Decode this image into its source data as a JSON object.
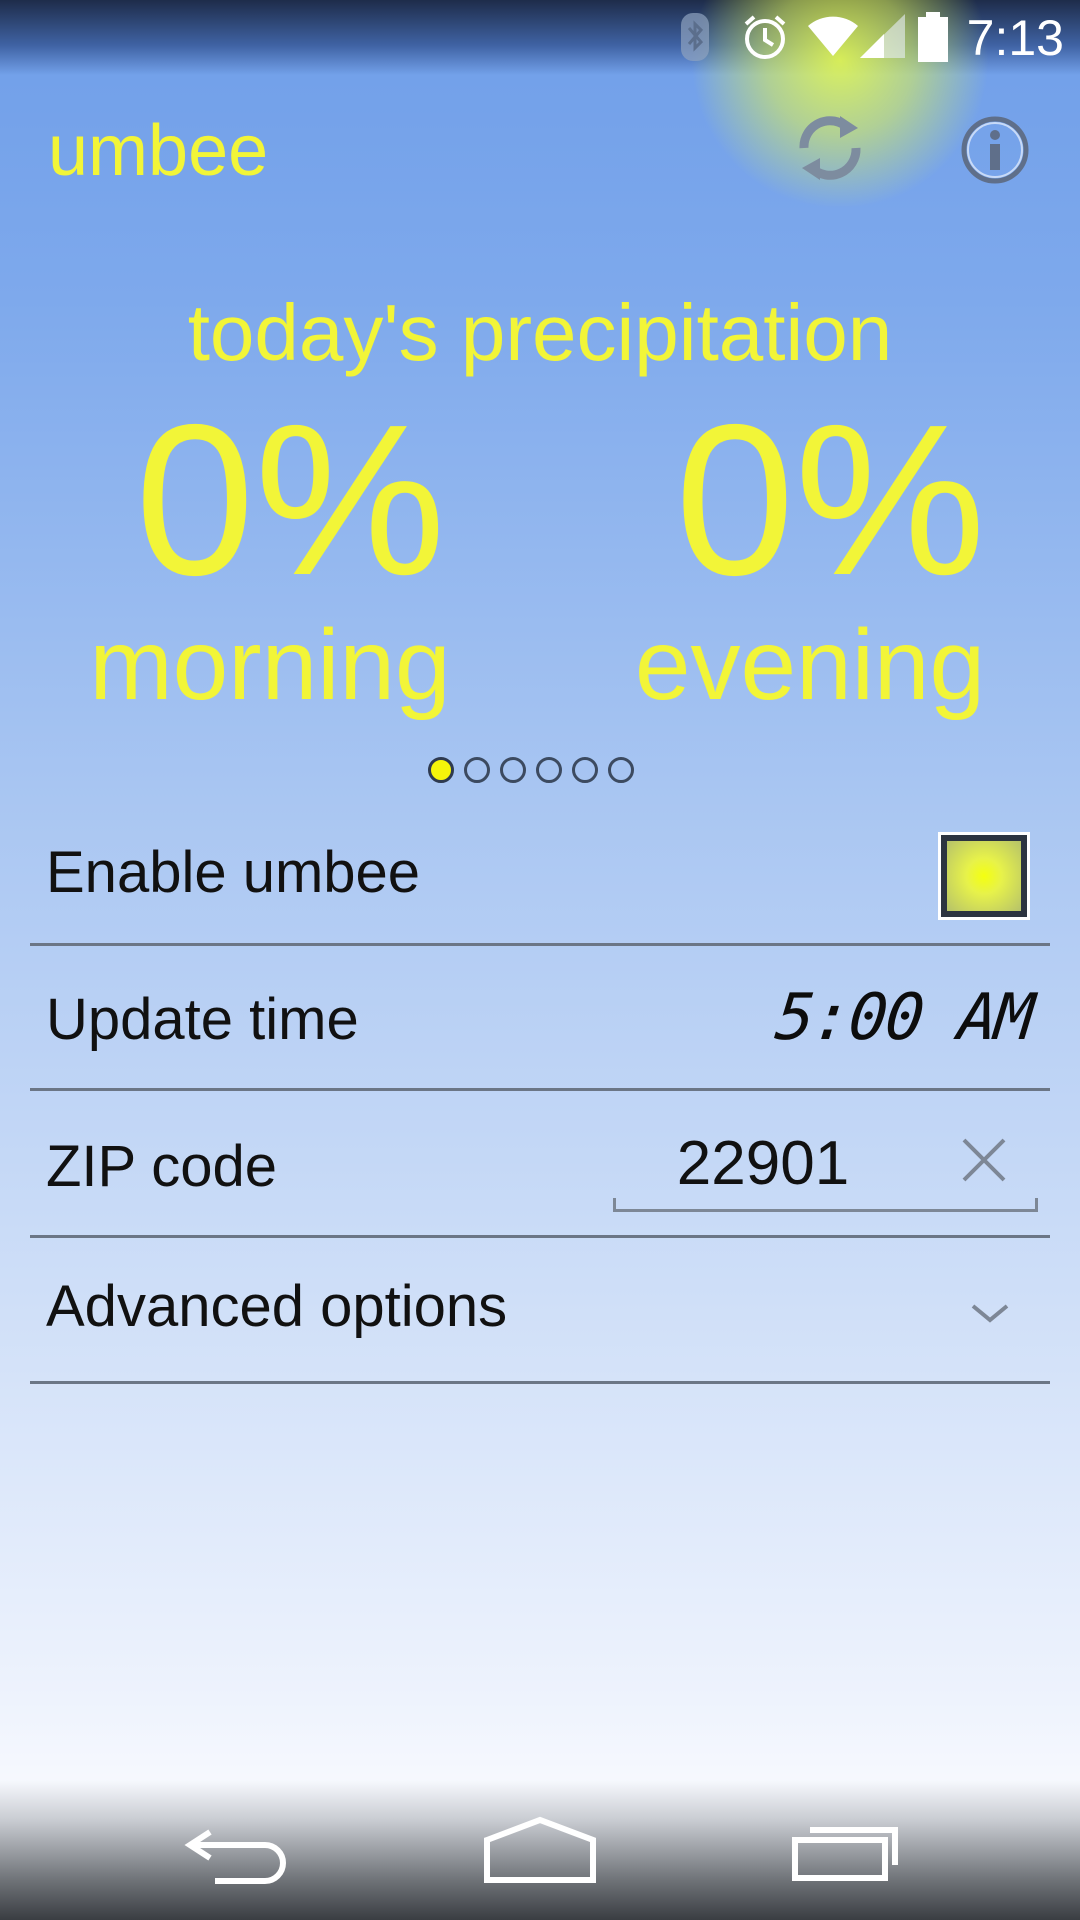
{
  "status_bar": {
    "time": "7:13",
    "icons": [
      "bluetooth-icon",
      "alarm-icon",
      "wifi-icon",
      "signal-icon",
      "battery-icon"
    ]
  },
  "app_bar": {
    "title": "umbee",
    "actions": [
      "refresh-icon",
      "info-icon"
    ]
  },
  "precipitation": {
    "title": "today's precipitation",
    "morning": {
      "value": "0%",
      "label": "morning"
    },
    "evening": {
      "value": "0%",
      "label": "evening"
    }
  },
  "pager": {
    "total": 6,
    "active_index": 0
  },
  "settings": {
    "enable": {
      "label": "Enable umbee",
      "checked": true
    },
    "update_time": {
      "label": "Update time",
      "value": "5:00 AM"
    },
    "zip": {
      "label": "ZIP code",
      "value": "22901"
    },
    "advanced": {
      "label": "Advanced options"
    }
  },
  "nav_bar": [
    "back-icon",
    "home-icon",
    "recent-apps-icon"
  ],
  "colors": {
    "accent_yellow": "#f2f538",
    "background_top": "#6f9ee9",
    "background_bottom": "#f7f9fe",
    "text_dark": "#111111"
  }
}
